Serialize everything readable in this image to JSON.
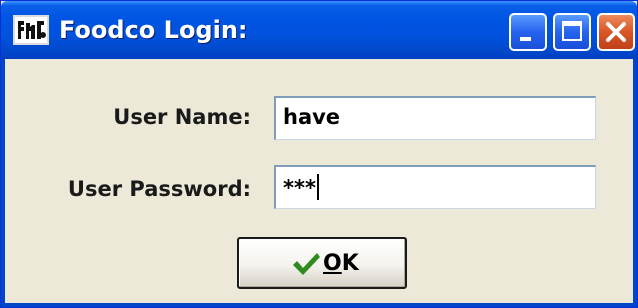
{
  "window": {
    "title": "Foodco Login:",
    "title_bar_color": "#0054e3",
    "icon": "foodco-app-icon",
    "controls": [
      "minimize-icon",
      "maximize-icon",
      "close-icon"
    ]
  },
  "form": {
    "username_label": "User Name:",
    "username_value": "have",
    "password_label": "User Password:",
    "password_value": "***"
  },
  "ok_button": {
    "mnemonic": "O",
    "rest": "K",
    "icon": "checkmark-icon",
    "icon_color": "#2e8b1e"
  },
  "colors": {
    "dialog_background": "#ece9d8",
    "close_button": "#d95525"
  }
}
